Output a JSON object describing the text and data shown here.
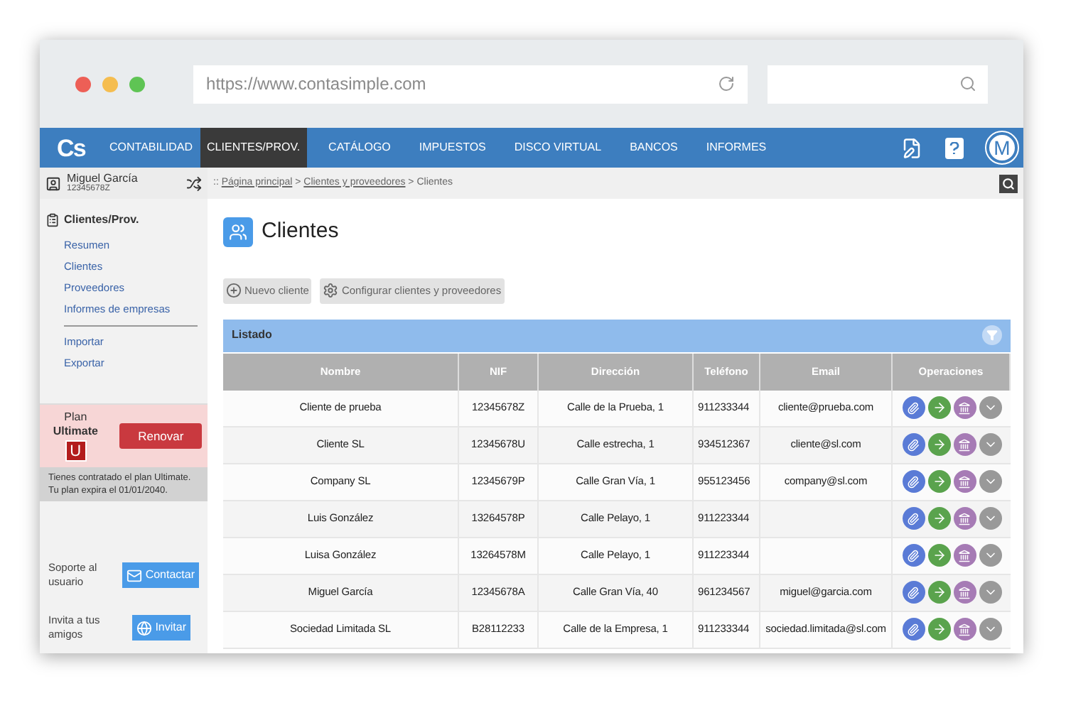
{
  "browser": {
    "url": "https://www.contasimple.com"
  },
  "navbar": {
    "logo": "Cs",
    "items": [
      {
        "label": "CONTABILIDAD",
        "selected": false
      },
      {
        "label": "CLIENTES/PROV.",
        "selected": true
      },
      {
        "label": "CATÁLOGO",
        "selected": false
      },
      {
        "label": "IMPUESTOS",
        "selected": false
      },
      {
        "label": "DISCO VIRTUAL",
        "selected": false
      },
      {
        "label": "BANCOS",
        "selected": false
      },
      {
        "label": "INFORMES",
        "selected": false
      }
    ],
    "avatar": "M"
  },
  "user": {
    "name": "Miguel García",
    "nif": "12345678Z"
  },
  "breadcrumb": {
    "prefix": "::",
    "separator": ">",
    "items": [
      {
        "label": "Página principal",
        "link": true
      },
      {
        "label": "Clientes y proveedores",
        "link": true
      },
      {
        "label": "Clientes",
        "link": false
      }
    ]
  },
  "sidebar": {
    "section": "Clientes/Prov.",
    "groups": [
      [
        "Resumen",
        "Clientes",
        "Proveedores",
        "Informes de empresas"
      ],
      [
        "Importar",
        "Exportar"
      ]
    ],
    "plan": {
      "label": "Plan",
      "name": "Ultimate",
      "badge": "U",
      "button": "Renovar",
      "note": "Tienes contratado el plan Ultimate. Tu plan expira el 01/01/2040."
    },
    "support": {
      "label": "Soporte al usuario",
      "button": "Contactar"
    },
    "invite": {
      "label": "Invita a tus amigos",
      "button": "Invitar"
    }
  },
  "page": {
    "title": "Clientes",
    "buttons": [
      {
        "kind": "add",
        "label": "Nuevo cliente"
      },
      {
        "kind": "settings",
        "label": "Configurar clientes y proveedores"
      }
    ]
  },
  "table": {
    "title": "Listado",
    "columns": [
      "Nombre",
      "NIF",
      "Dirección",
      "Teléfono",
      "Email",
      "Operaciones"
    ],
    "rows": [
      {
        "name": "Cliente de prueba",
        "nif": "12345678Z",
        "address": "Calle de la Prueba, 1",
        "phone": "911233344",
        "email": "cliente@prueba.com"
      },
      {
        "name": "Cliente SL",
        "nif": "12345678U",
        "address": "Calle estrecha, 1",
        "phone": "934512367",
        "email": "cliente@sl.com"
      },
      {
        "name": "Company SL",
        "nif": "12345679P",
        "address": "Calle Gran Vía, 1",
        "phone": "955123456",
        "email": "company@sl.com"
      },
      {
        "name": "Luis González",
        "nif": "13264578P",
        "address": "Calle Pelayo, 1",
        "phone": "911223344"
      },
      {
        "name": "Luisa González",
        "nif": "13264578M",
        "address": "Calle Pelayo, 1",
        "phone": "911223344"
      },
      {
        "name": "Miguel García",
        "nif": "12345678A",
        "address": "Calle Gran Vía, 40",
        "phone": "961234567",
        "email": "miguel@garcia.com"
      },
      {
        "name": "Sociedad Limitada SL",
        "nif": "B28112233",
        "address": "Calle de la Empresa, 1",
        "phone": "911233344",
        "email": "sociedad.limitada@sl.com"
      }
    ]
  }
}
